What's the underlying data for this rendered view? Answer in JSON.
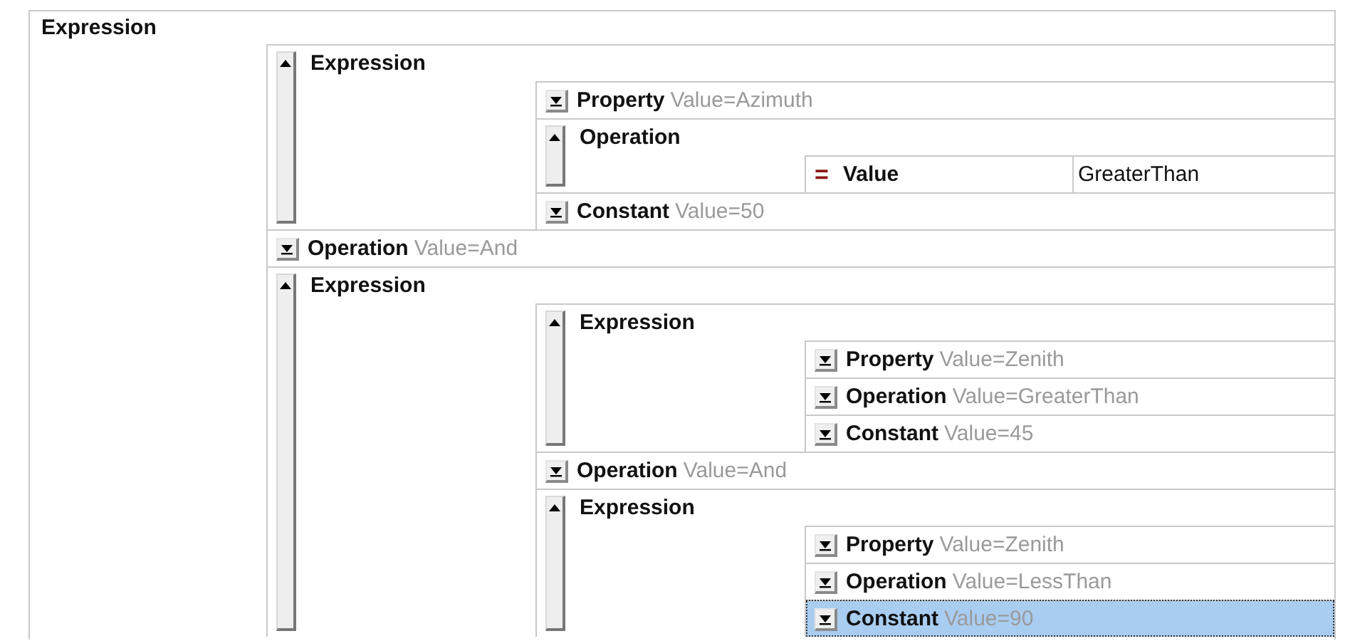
{
  "root": {
    "label": "Expression",
    "children": [
      {
        "kind": "node",
        "label": "Expression",
        "expanded": true,
        "selected": false,
        "children": [
          {
            "kind": "node",
            "label": "Property",
            "value": "Value=Azimuth",
            "expanded": false,
            "selected": false
          },
          {
            "kind": "node",
            "label": "Operation",
            "expanded": true,
            "selected": false,
            "children": [
              {
                "kind": "value",
                "marker": "=",
                "label": "Value",
                "value": "GreaterThan",
                "selected": false
              }
            ]
          },
          {
            "kind": "node",
            "label": "Constant",
            "value": "Value=50",
            "expanded": false,
            "selected": false
          }
        ]
      },
      {
        "kind": "node",
        "label": "Operation",
        "value": "Value=And",
        "expanded": false,
        "selected": false
      },
      {
        "kind": "node",
        "label": "Expression",
        "expanded": true,
        "selected": false,
        "children": [
          {
            "kind": "node",
            "label": "Expression",
            "expanded": true,
            "selected": false,
            "children": [
              {
                "kind": "node",
                "label": "Property",
                "value": "Value=Zenith",
                "expanded": false,
                "selected": false
              },
              {
                "kind": "node",
                "label": "Operation",
                "value": "Value=GreaterThan",
                "expanded": false,
                "selected": false
              },
              {
                "kind": "node",
                "label": "Constant",
                "value": "Value=45",
                "expanded": false,
                "selected": false
              }
            ]
          },
          {
            "kind": "node",
            "label": "Operation",
            "value": "Value=And",
            "expanded": false,
            "selected": false
          },
          {
            "kind": "node",
            "label": "Expression",
            "expanded": true,
            "selected": false,
            "children": [
              {
                "kind": "node",
                "label": "Property",
                "value": "Value=Zenith",
                "expanded": false,
                "selected": false
              },
              {
                "kind": "node",
                "label": "Operation",
                "value": "Value=LessThan",
                "expanded": false,
                "selected": false
              },
              {
                "kind": "node",
                "label": "Constant",
                "value": "Value=90",
                "expanded": false,
                "selected": true
              }
            ]
          }
        ]
      }
    ]
  }
}
